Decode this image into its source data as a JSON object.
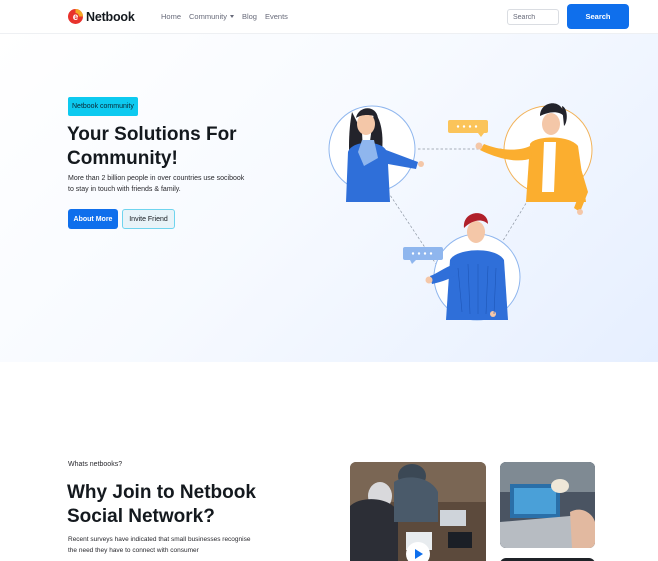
{
  "brand": {
    "name": "Netbook"
  },
  "nav": {
    "items": [
      {
        "label": "Home",
        "has_dropdown": false
      },
      {
        "label": "Community",
        "has_dropdown": true
      },
      {
        "label": "Blog",
        "has_dropdown": false
      },
      {
        "label": "Events",
        "has_dropdown": false
      }
    ],
    "search_placeholder": "Search",
    "search_button": "Search"
  },
  "hero": {
    "badge": "Netbook community",
    "title": "Your Solutions For Community!",
    "description": "More than 2 billion people in over countries use socibook to stay in touch with friends & family.",
    "primary_button": "About More",
    "secondary_button": "Invite Friend"
  },
  "section": {
    "eyebrow": "Whats netbooks?",
    "title": "Why Join to Netbook Social Network?",
    "description": "Recent surveys have indicated that small businesses recognise the need they have to connect with consumer"
  },
  "colors": {
    "primary": "#0f6fec",
    "info": "#0dcaf0",
    "dark": "#14191e",
    "muted": "#676a79",
    "logo_red": "#e8322c",
    "logo_orange": "#f5a623",
    "shirt_yellow": "#fbae2f",
    "shirt_blue": "#2f6fd9",
    "hair_dark": "#23232b",
    "hair_red": "#b0202a"
  },
  "icons": {
    "logo": "netbook-logo-icon",
    "dropdown": "chevron-down-icon",
    "play": "play-icon",
    "chat": "chat-bubble-icon"
  }
}
